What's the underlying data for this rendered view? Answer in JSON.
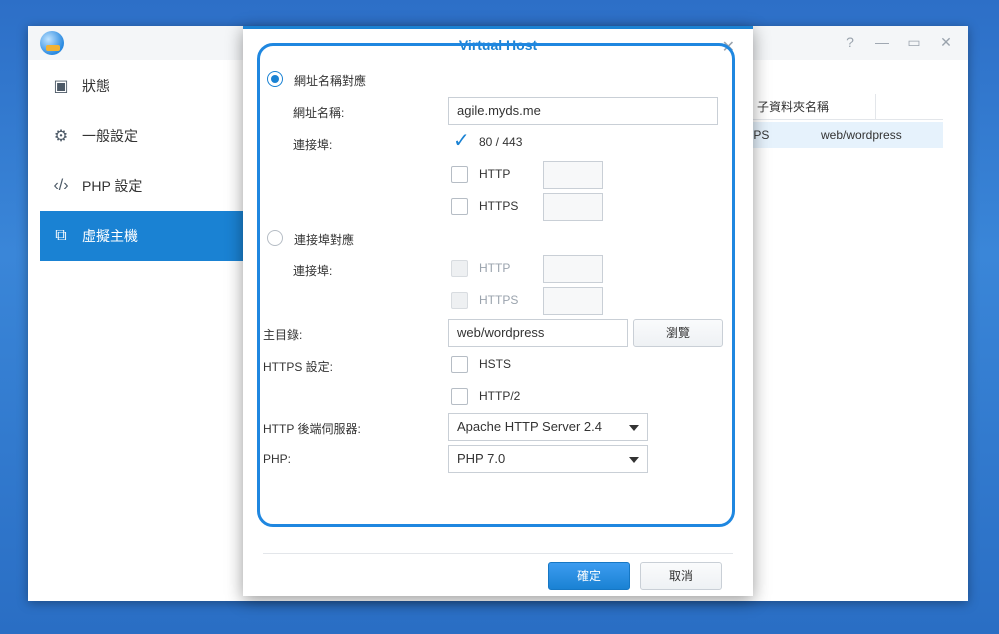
{
  "sidebar": {
    "items": [
      {
        "label": "狀態",
        "icon": "status-card-icon"
      },
      {
        "label": "一般設定",
        "icon": "gear-icon"
      },
      {
        "label": "PHP 設定",
        "icon": "code-icon"
      },
      {
        "label": "虛擬主機",
        "icon": "virtual-host-icon"
      }
    ]
  },
  "main": {
    "column_header": "子資料夾名稱",
    "row": {
      "protocol": "TPS",
      "folder": "web/wordpress"
    }
  },
  "dialog": {
    "title": "Virtual Host",
    "hostname_mode_label": "網址名稱對應",
    "hostname_label": "網址名稱:",
    "hostname_value": "agile.myds.me",
    "port_label": "連接埠:",
    "port_default": "80 / 443",
    "http_label": "HTTP",
    "https_label": "HTTPS",
    "port_mode_label": "連接埠對應",
    "port_label2": "連接埠:",
    "http_label2": "HTTP",
    "https_label2": "HTTPS",
    "doc_root_label": "主目錄:",
    "doc_root_value": "web/wordpress",
    "browse_label": "瀏覽",
    "https_settings_label": "HTTPS 設定:",
    "hsts_label": "HSTS",
    "http2_label": "HTTP/2",
    "backend_label": "HTTP 後端伺服器:",
    "backend_value": "Apache HTTP Server 2.4",
    "php_label": "PHP:",
    "php_value": "PHP 7.0",
    "ok_label": "確定",
    "cancel_label": "取消"
  },
  "colors": {
    "accent": "#1a82d3",
    "highlight": "#1f87e0"
  }
}
